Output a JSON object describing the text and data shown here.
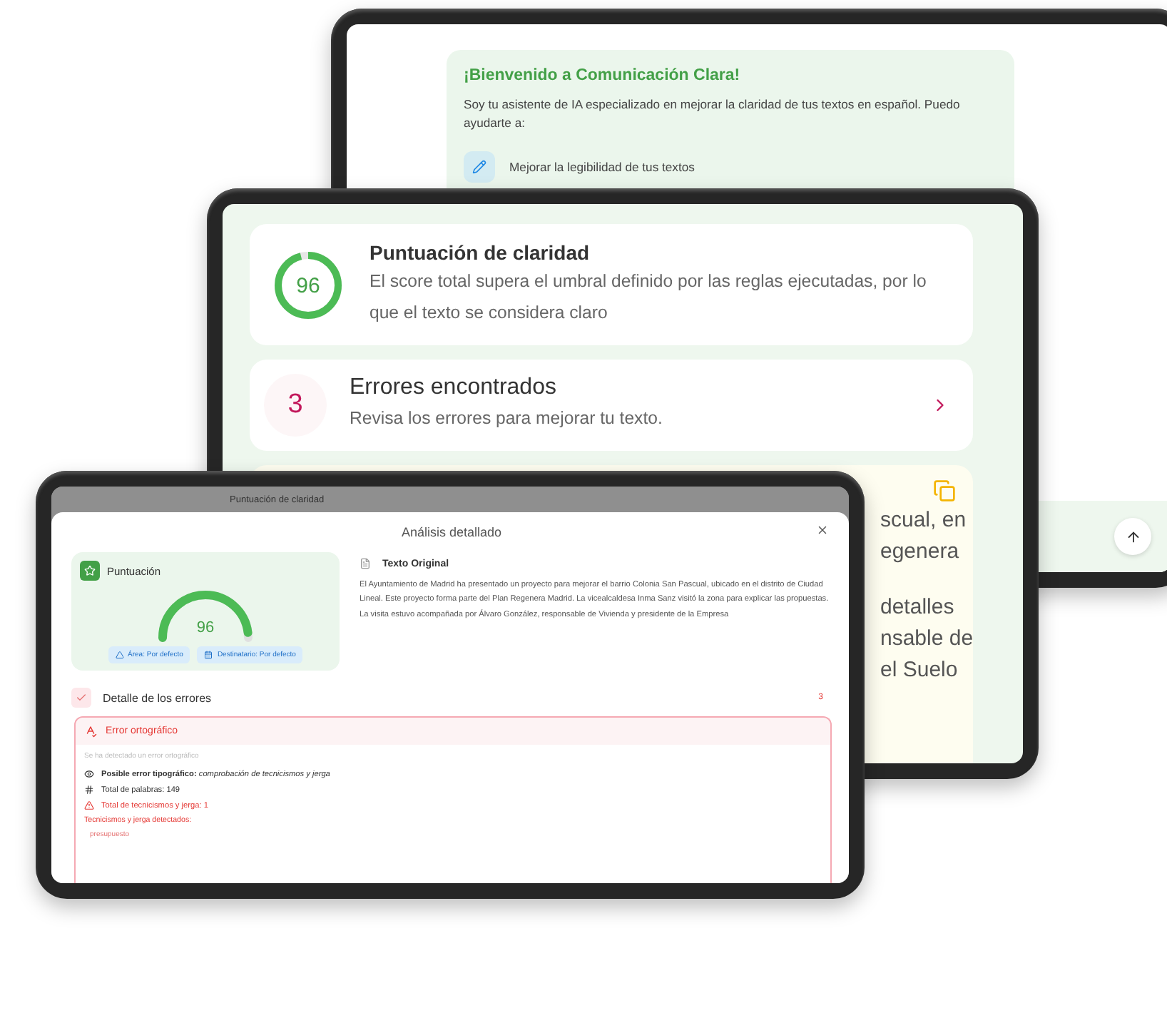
{
  "back_tablet": {
    "welcome": {
      "title": "¡Bienvenido a Comunicación Clara!",
      "body": "Soy tu asistente de IA especializado en mejorar la claridad de tus textos en español. Puedo ayudarte a:",
      "features": [
        {
          "label": "Mejorar la legibilidad de tus textos"
        }
      ]
    }
  },
  "middle_tablet": {
    "score_card": {
      "score": "96",
      "level": 0.96,
      "title": "Puntuación de claridad",
      "description": "El score total supera el umbral definido por las reglas ejecutadas, por lo que el texto se considera claro"
    },
    "errors_card": {
      "count": "3",
      "title": "Errores encontrados",
      "subtitle": "Revisa los errores para mejorar tu texto."
    },
    "summary_card": {
      "paragraphs": [
        {
          "lines": [
            "scual, en",
            "egenera"
          ]
        },
        {
          "lines": [
            "detalles",
            "nsable de",
            "el Suelo"
          ]
        }
      ]
    }
  },
  "front_tablet": {
    "background_title": "Puntuación de claridad",
    "modal": {
      "title": "Análisis detallado",
      "score_panel": {
        "title": "Puntuación",
        "score": "96",
        "level": 0.96,
        "chips": [
          {
            "kind": "area",
            "label": "Área: Por defecto"
          },
          {
            "kind": "audience",
            "label": "Destinatario: Por defecto"
          }
        ]
      },
      "original_text": {
        "title": "Texto Original",
        "body": "El Ayuntamiento de Madrid ha presentado un proyecto para mejorar el barrio Colonia San Pascual, ubicado en el distrito de Ciudad Lineal. Este proyecto forma parte del Plan Regenera Madrid. La vicealcaldesa Inma Sanz visitó la zona para explicar las propuestas. La visita estuvo acompañada por Álvaro González, responsable de Vivienda y presidente de la Empresa"
      },
      "errors_section": {
        "title": "Detalle de los errores",
        "count": "3"
      },
      "error": {
        "title": "Error ortográfico",
        "message": "Se ha detectado un error ortográfico",
        "details": [
          {
            "kind": "typo",
            "text": "**Posible error tipográfico:** *comprobación de tecnicismos y jerga*"
          },
          {
            "kind": "count",
            "text": "Total de palabras: 149"
          },
          {
            "kind": "warning",
            "text": "Total de tecnicismos y jerga: 1"
          }
        ],
        "list_title": "Tecnicismos y jerga detectados:",
        "terms": [
          "presupuesto"
        ]
      }
    }
  }
}
